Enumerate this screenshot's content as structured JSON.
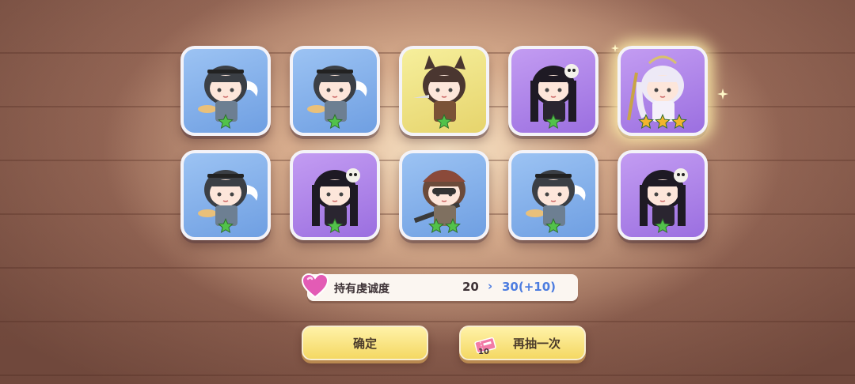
{
  "cards": [
    {
      "rarity_color": "blue",
      "character": "chef-girl-icon",
      "stars": 1
    },
    {
      "rarity_color": "blue",
      "character": "chef-girl-icon",
      "stars": 1
    },
    {
      "rarity_color": "yellow",
      "character": "fox-girl-icon",
      "stars": 1
    },
    {
      "rarity_color": "purple",
      "character": "skull-girl-icon",
      "stars": 1
    },
    {
      "rarity_color": "purple",
      "character": "white-hair-girl-icon",
      "stars": 3
    },
    {
      "rarity_color": "blue",
      "character": "chef-girl-icon",
      "stars": 1
    },
    {
      "rarity_color": "purple",
      "character": "skull-girl-icon",
      "stars": 1
    },
    {
      "rarity_color": "blue",
      "character": "soldier-girl-icon",
      "stars": 2
    },
    {
      "rarity_color": "blue",
      "character": "chef-girl-icon",
      "stars": 1
    },
    {
      "rarity_color": "purple",
      "character": "skull-girl-icon",
      "stars": 1
    }
  ],
  "devotion": {
    "label": "持有虔诚度",
    "from": "20",
    "arrow": "›",
    "to": "30(+10)"
  },
  "buttons": {
    "confirm": "确定",
    "again": "再抽一次",
    "ticket_count": "10"
  },
  "colors": {
    "blue": "#7fa9e8",
    "yellow": "#ede07e",
    "purple": "#ad83e8",
    "star_green": "#52c24a",
    "star_gold": "#f3b52c",
    "accent_blue": "#4d7de0"
  }
}
